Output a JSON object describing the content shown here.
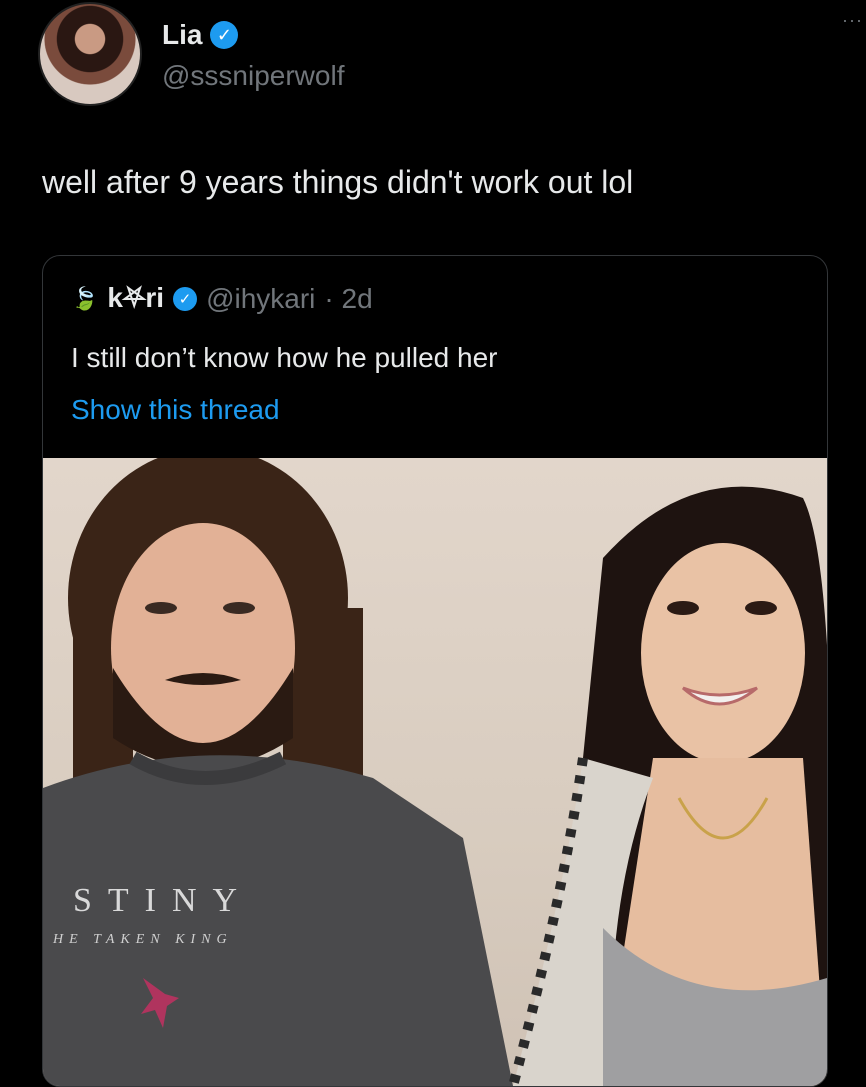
{
  "tweet": {
    "author_name": "Lia",
    "author_handle": "@sssniperwolf",
    "more_label": "···",
    "text": "well after 9 years things didn't work out lol"
  },
  "quoted": {
    "prefix_symbols": "🍃",
    "author_name": "k⛧ri",
    "author_handle": "@ihykari",
    "time": "· 2d",
    "text": "I still don’t know how he pulled her",
    "show_thread": "Show this thread"
  },
  "photo": {
    "shirt_line1": "STINY",
    "shirt_line2": "HE TAKEN KING"
  },
  "colors": {
    "accent": "#1d9bf0",
    "muted": "#71767b",
    "text": "#e7e9ea",
    "background": "#000000"
  },
  "icons": {
    "verified": "verified-badge-icon",
    "more": "more-options-icon"
  }
}
